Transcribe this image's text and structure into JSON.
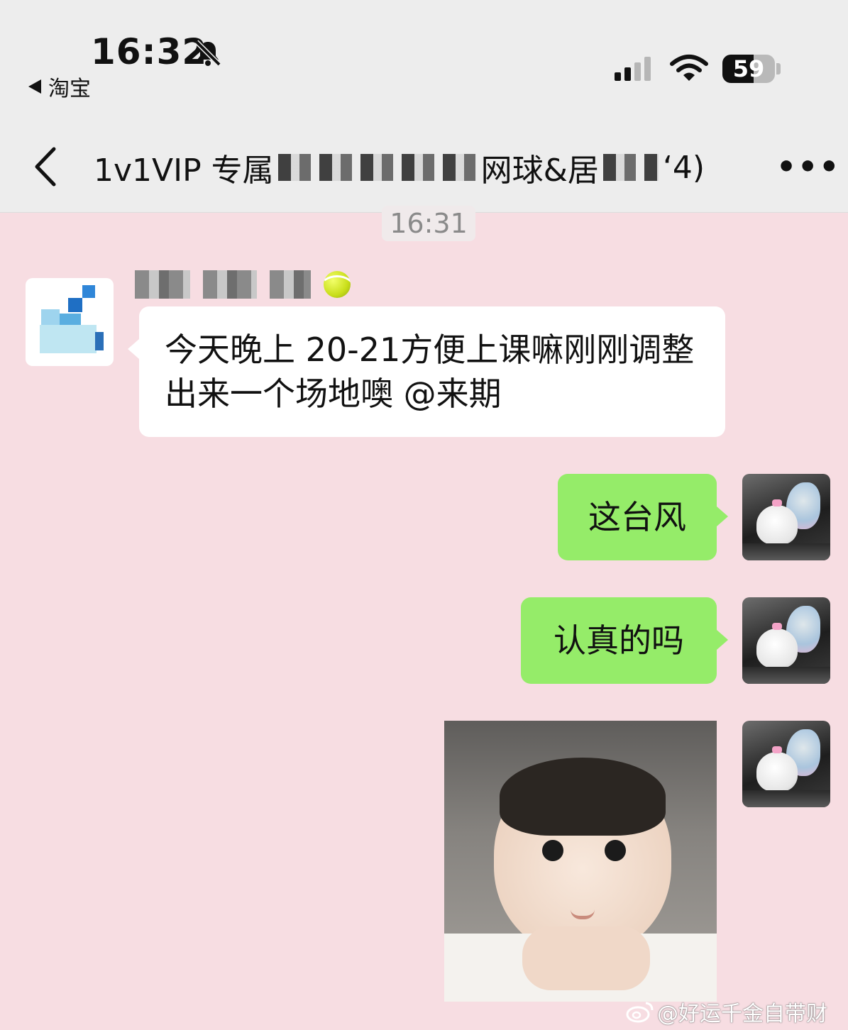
{
  "status_bar": {
    "time": "16:32",
    "back_app_label": "淘宝",
    "battery_level": "59",
    "battery_fraction": 0.59,
    "signal_bars": 2
  },
  "nav": {
    "title_prefix": "1v1VIP 专属",
    "title_middle": "网球&居",
    "title_suffix": "‘4)",
    "more_label": "•••"
  },
  "chat": {
    "timestamp": "16:31",
    "messages": [
      {
        "side": "left",
        "text": "今天晚上 20-21方便上课嘛刚刚调整出来一个场地噢 @来期"
      },
      {
        "side": "right",
        "text": "这台风"
      },
      {
        "side": "right",
        "text": "认真的吗"
      },
      {
        "side": "right",
        "type": "sticker",
        "icon": "baby-sticker"
      }
    ]
  },
  "watermark": {
    "text": "@好运千金自带财",
    "icon": "weibo-icon"
  },
  "colors": {
    "chat_background": "#f7dde2",
    "top_bar": "#ededed",
    "sent_bubble": "#95ec69",
    "received_bubble": "#ffffff"
  }
}
